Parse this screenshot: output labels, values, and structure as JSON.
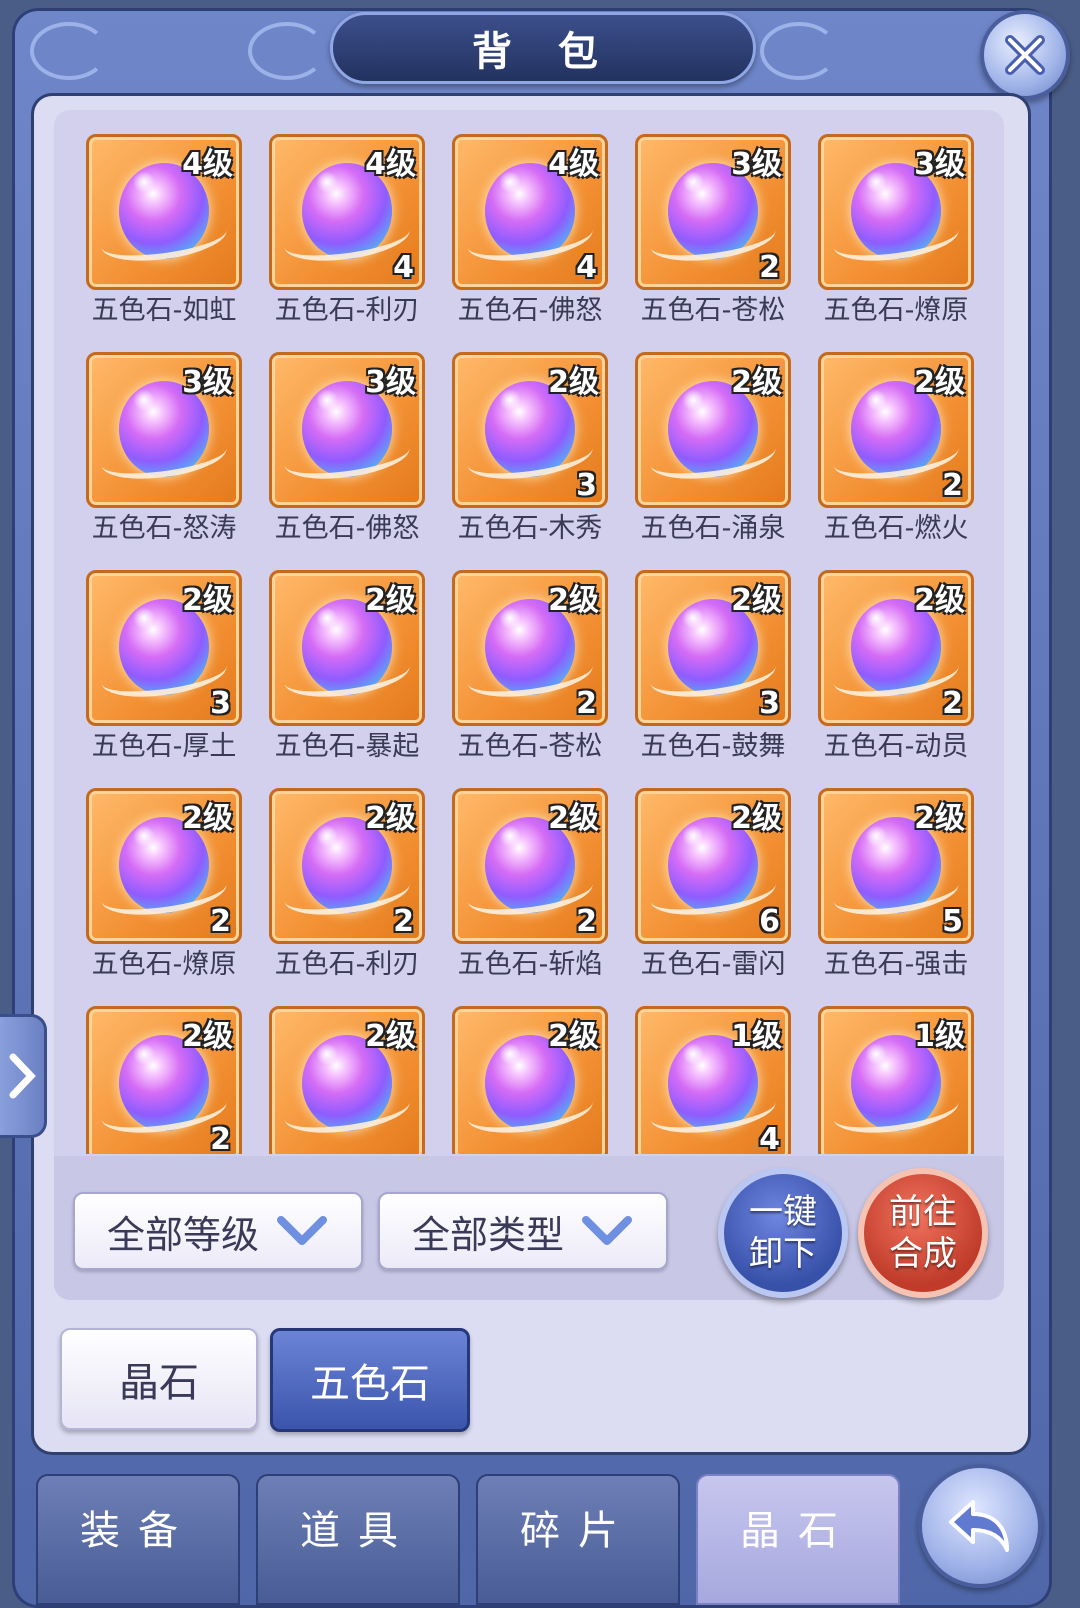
{
  "window": {
    "title": "背 包"
  },
  "icons": {
    "close": "close-icon",
    "expand": "chevron-right-icon",
    "back": "back-arrow-icon",
    "dropdown": "chevron-down-icon"
  },
  "items": [
    {
      "name": "五色石-如虹",
      "level": "4级",
      "count": ""
    },
    {
      "name": "五色石-利刃",
      "level": "4级",
      "count": "4"
    },
    {
      "name": "五色石-佛怒",
      "level": "4级",
      "count": "4"
    },
    {
      "name": "五色石-苍松",
      "level": "3级",
      "count": "2"
    },
    {
      "name": "五色石-燎原",
      "level": "3级",
      "count": ""
    },
    {
      "name": "五色石-怒涛",
      "level": "3级",
      "count": ""
    },
    {
      "name": "五色石-佛怒",
      "level": "3级",
      "count": ""
    },
    {
      "name": "五色石-木秀",
      "level": "2级",
      "count": "3"
    },
    {
      "name": "五色石-涌泉",
      "level": "2级",
      "count": ""
    },
    {
      "name": "五色石-燃火",
      "level": "2级",
      "count": "2"
    },
    {
      "name": "五色石-厚土",
      "level": "2级",
      "count": "3"
    },
    {
      "name": "五色石-暴起",
      "level": "2级",
      "count": ""
    },
    {
      "name": "五色石-苍松",
      "level": "2级",
      "count": "2"
    },
    {
      "name": "五色石-鼓舞",
      "level": "2级",
      "count": "3"
    },
    {
      "name": "五色石-动员",
      "level": "2级",
      "count": "2"
    },
    {
      "name": "五色石-燎原",
      "level": "2级",
      "count": "2"
    },
    {
      "name": "五色石-利刃",
      "level": "2级",
      "count": "2"
    },
    {
      "name": "五色石-斩焰",
      "level": "2级",
      "count": "2"
    },
    {
      "name": "五色石-雷闪",
      "level": "2级",
      "count": "6"
    },
    {
      "name": "五色石-强击",
      "level": "2级",
      "count": "5"
    },
    {
      "name": "",
      "level": "2级",
      "count": "2"
    },
    {
      "name": "",
      "level": "2级",
      "count": ""
    },
    {
      "name": "",
      "level": "2级",
      "count": ""
    },
    {
      "name": "",
      "level": "1级",
      "count": "4"
    },
    {
      "name": "",
      "level": "1级",
      "count": ""
    }
  ],
  "filters": {
    "level_label": "全部等级",
    "type_label": "全部类型"
  },
  "actions": {
    "unequip_line1": "一键",
    "unequip_line2": "卸下",
    "synth_line1": "前往",
    "synth_line2": "合成"
  },
  "categories": [
    {
      "label": "晶石",
      "active": false
    },
    {
      "label": "五色石",
      "active": true
    }
  ],
  "bottom_tabs": [
    {
      "label": "装备",
      "active": false
    },
    {
      "label": "道具",
      "active": false
    },
    {
      "label": "碎片",
      "active": false
    },
    {
      "label": "晶石",
      "active": true
    }
  ]
}
